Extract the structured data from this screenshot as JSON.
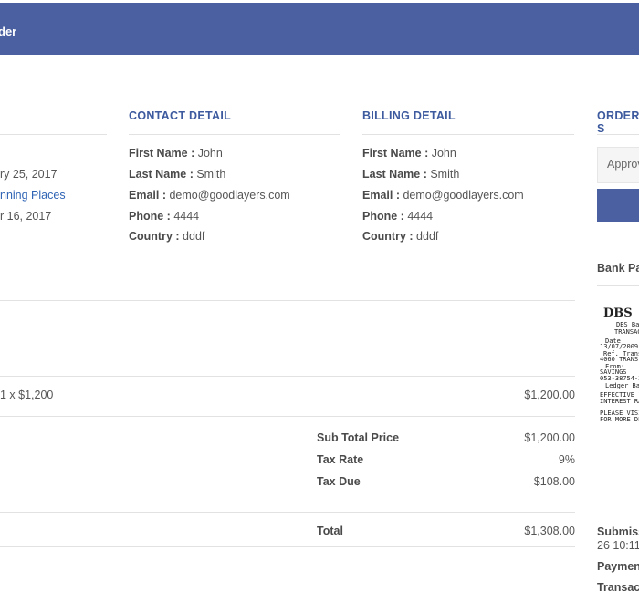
{
  "header": {
    "title": "der"
  },
  "left_column": {
    "date_1": "ry 25, 2017",
    "link": "nning Places",
    "date_2": "r 16, 2017"
  },
  "contact": {
    "title": "CONTACT DETAIL",
    "first_name_label": "First Name :",
    "first_name": "John",
    "last_name_label": "Last Name :",
    "last_name": "Smith",
    "email_label": "Email :",
    "email": "demo@goodlayers.com",
    "phone_label": "Phone :",
    "phone": "4444",
    "country_label": "Country :",
    "country": "dddf"
  },
  "billing": {
    "title": "BILLING DETAIL",
    "first_name_label": "First Name :",
    "first_name": "John",
    "last_name_label": "Last Name :",
    "last_name": "Smith",
    "email_label": "Email :",
    "email": "demo@goodlayers.com",
    "phone_label": "Phone :",
    "phone": "4444",
    "country_label": "Country :",
    "country": "dddf"
  },
  "order_status": {
    "title": "ORDER S",
    "select_value": "Approv",
    "payment_title": "Bank Pa"
  },
  "line_item": {
    "qty_price": "1 x $1,200",
    "amount": "$1,200.00"
  },
  "totals": {
    "subtotal_label": "Sub Total Price",
    "subtotal": "$1,200.00",
    "tax_rate_label": "Tax Rate",
    "tax_rate": "9%",
    "tax_due_label": "Tax Due",
    "tax_due": "$108.00",
    "total_label": "Total",
    "total": "$1,308.00"
  },
  "receipt": {
    "brand": "DBS",
    "lines": [
      "DBS Bank Lt",
      "TRANSAC",
      "Date",
      "13/07/2009",
      "Ref.   Trans",
      "4060  TRANS",
      "From:",
      "SAVINGS",
      "053-38754-3",
      "Ledger Bal",
      "EFFECTIVE 1",
      "INTEREST RA",
      "PLEASE VISI",
      "FOR MORE DE"
    ]
  },
  "side_info": {
    "submitted": "Submiss",
    "submitted_time": "26 10:11:",
    "payment": "Payment",
    "transaction": "Transact"
  }
}
